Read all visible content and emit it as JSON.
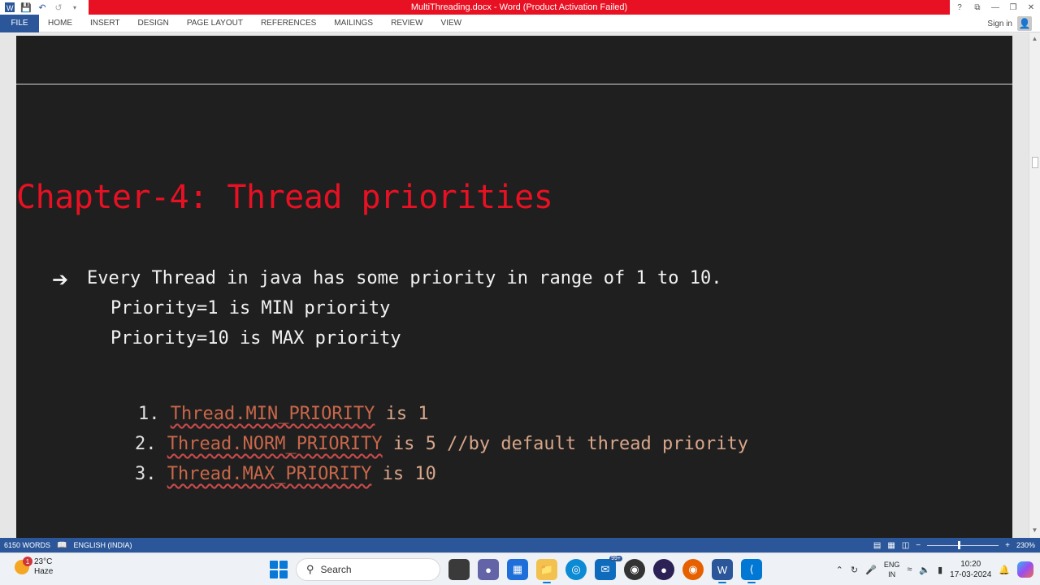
{
  "window": {
    "title": "MultiThreading.docx - Word (Product Activation Failed)"
  },
  "ribbon": {
    "tabs": [
      "FILE",
      "HOME",
      "INSERT",
      "DESIGN",
      "PAGE LAYOUT",
      "REFERENCES",
      "MAILINGS",
      "REVIEW",
      "VIEW"
    ],
    "sign_in": "Sign in"
  },
  "document": {
    "chapter_title": "Chapter-4: Thread priorities",
    "bullet_line": "Every Thread in java has some priority in range of 1 to 10.",
    "sub_lines": [
      "Priority=1 is MIN priority",
      "Priority=10 is MAX priority"
    ],
    "numbered_items": [
      {
        "num": "1.",
        "code": "Thread.MIN_PRIORITY",
        "rest": " is 1",
        "comment": ""
      },
      {
        "num": "2.",
        "code": "Thread.NORM_PRIORITY",
        "rest": " is 5",
        "comment": "  //by default thread priority"
      },
      {
        "num": "3.",
        "code": "Thread.MAX_PRIORITY",
        "rest": " is 10",
        "comment": ""
      }
    ]
  },
  "statusbar": {
    "words": "6150 WORDS",
    "language": "ENGLISH (INDIA)",
    "zoom": "230%"
  },
  "taskbar": {
    "weather_temp": "23°C",
    "weather_desc": "Haze",
    "weather_badge": "1",
    "search_placeholder": "Search",
    "mail_badge": "99+",
    "lang_top": "ENG",
    "lang_bottom": "IN",
    "time": "10:20",
    "date": "17-03-2024"
  },
  "colors": {
    "title_bar_red": "#e81123",
    "word_blue": "#2b579a",
    "page_bg": "#1f1f1f",
    "chapter_red": "#e81123"
  }
}
